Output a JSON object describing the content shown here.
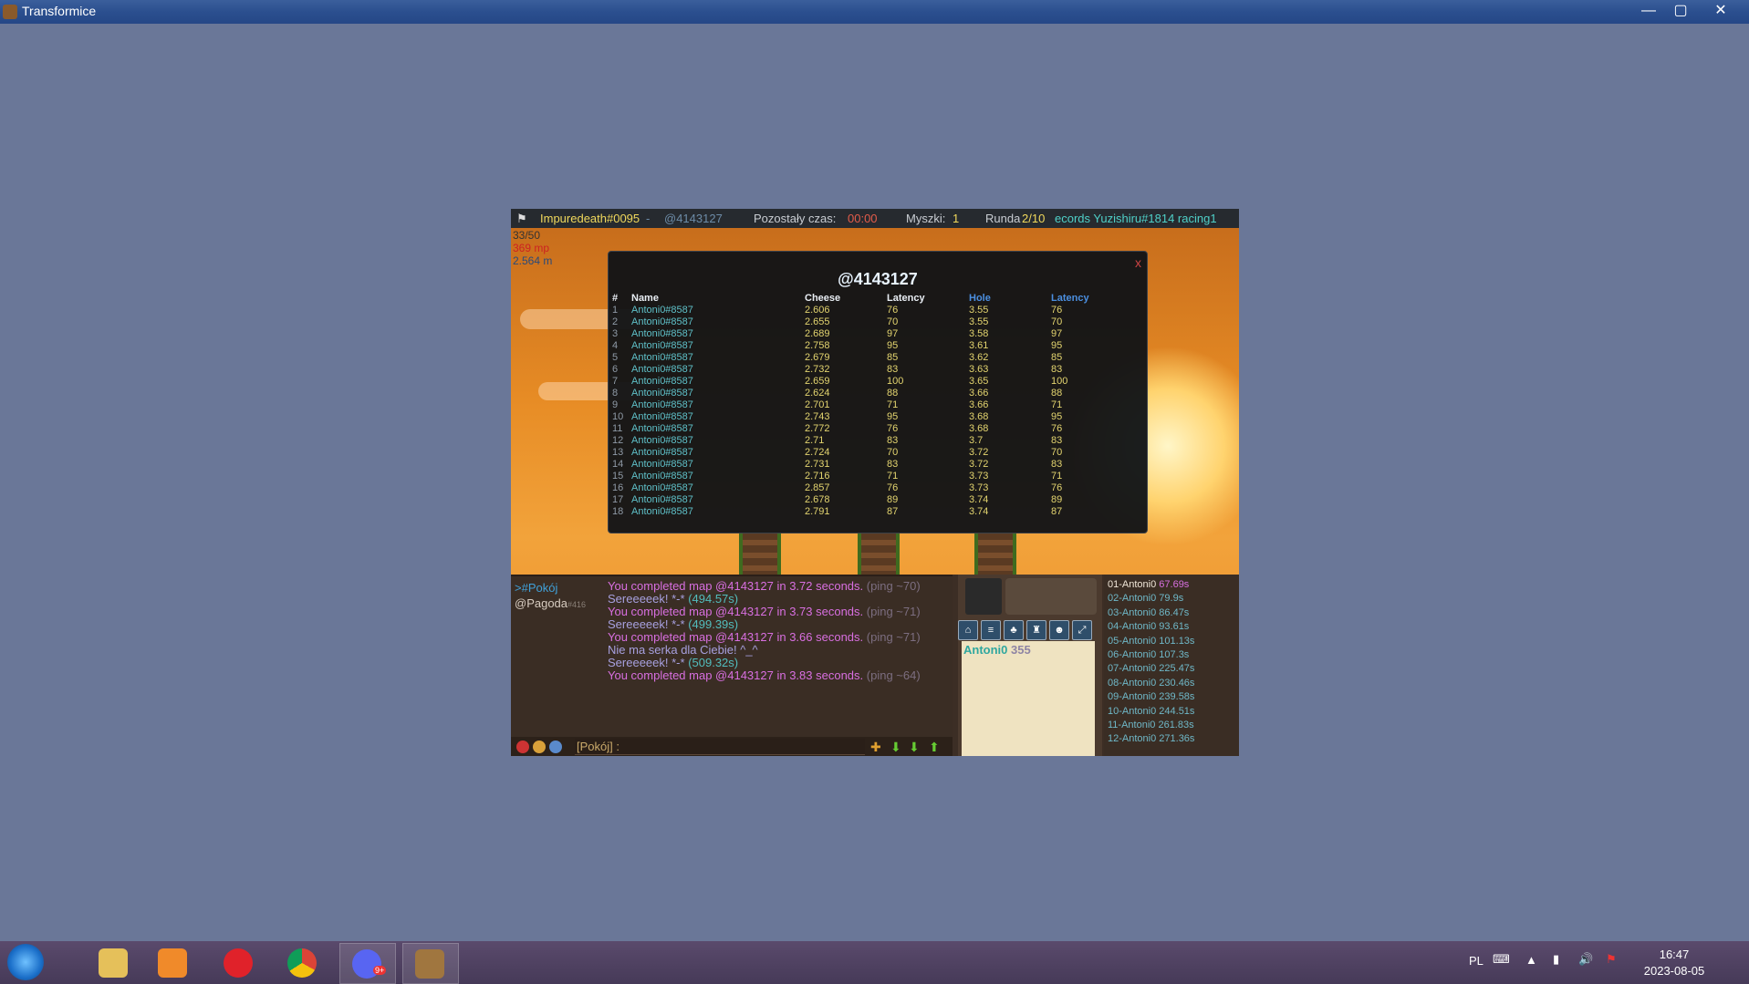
{
  "window": {
    "title": "Transformice",
    "minimize": "—",
    "maximize": "▢",
    "close": "✕"
  },
  "topbar": {
    "player": "Impuredeath#0095",
    "sep": " - ",
    "map": "@4143127",
    "time_label": "Pozostały czas:",
    "time_value": "00:00",
    "mice_label": "Myszki:",
    "mice_value": "1",
    "round_label": "Runda",
    "round_value": "2/10",
    "records_text": "ecords Yuzishiru#1814 racing1"
  },
  "stats": [
    "33/50",
    "369 mp",
    "2.564 m"
  ],
  "dialog": {
    "title": "@4143127",
    "close": "x",
    "headers": [
      "#",
      "Name",
      "Cheese",
      "Latency",
      "Hole",
      "Latency"
    ],
    "rows": [
      [
        "1",
        "Antoni0#8587",
        "2.606",
        "76",
        "3.55",
        "76"
      ],
      [
        "2",
        "Antoni0#8587",
        "2.655",
        "70",
        "3.55",
        "70"
      ],
      [
        "3",
        "Antoni0#8587",
        "2.689",
        "97",
        "3.58",
        "97"
      ],
      [
        "4",
        "Antoni0#8587",
        "2.758",
        "95",
        "3.61",
        "95"
      ],
      [
        "5",
        "Antoni0#8587",
        "2.679",
        "85",
        "3.62",
        "85"
      ],
      [
        "6",
        "Antoni0#8587",
        "2.732",
        "83",
        "3.63",
        "83"
      ],
      [
        "7",
        "Antoni0#8587",
        "2.659",
        "100",
        "3.65",
        "100"
      ],
      [
        "8",
        "Antoni0#8587",
        "2.624",
        "88",
        "3.66",
        "88"
      ],
      [
        "9",
        "Antoni0#8587",
        "2.701",
        "71",
        "3.66",
        "71"
      ],
      [
        "10",
        "Antoni0#8587",
        "2.743",
        "95",
        "3.68",
        "95"
      ],
      [
        "11",
        "Antoni0#8587",
        "2.772",
        "76",
        "3.68",
        "76"
      ],
      [
        "12",
        "Antoni0#8587",
        "2.71",
        "83",
        "3.7",
        "83"
      ],
      [
        "13",
        "Antoni0#8587",
        "2.724",
        "70",
        "3.72",
        "70"
      ],
      [
        "14",
        "Antoni0#8587",
        "2.731",
        "83",
        "3.72",
        "83"
      ],
      [
        "15",
        "Antoni0#8587",
        "2.716",
        "71",
        "3.73",
        "71"
      ],
      [
        "16",
        "Antoni0#8587",
        "2.857",
        "76",
        "3.73",
        "76"
      ],
      [
        "17",
        "Antoni0#8587",
        "2.678",
        "89",
        "3.74",
        "89"
      ],
      [
        "18",
        "Antoni0#8587",
        "2.791",
        "87",
        "3.74",
        "87"
      ]
    ]
  },
  "chat": {
    "channels": [
      ">#Pokój",
      "@Pagoda"
    ],
    "channel_suffix": "#416",
    "messages": [
      {
        "type": "m",
        "text": "You completed map @4143127 in 3.72 seconds.",
        "ping": "(ping ~70)"
      },
      {
        "type": "s",
        "text": "Sereeeeek! *-*",
        "time": "(494.57s)"
      },
      {
        "type": "m",
        "text": "You completed map @4143127 in 3.73 seconds.",
        "ping": "(ping ~71)"
      },
      {
        "type": "s",
        "text": "Sereeeeek! *-*",
        "time": "(499.39s)"
      },
      {
        "type": "m",
        "text": "You completed map @4143127 in 3.66 seconds.",
        "ping": "(ping ~71)"
      },
      {
        "type": "s",
        "text": "Nie ma serka dla Ciebie! ^_^",
        "time": ""
      },
      {
        "type": "s",
        "text": "Sereeeeek! *-*",
        "time": "(509.32s)"
      },
      {
        "type": "m",
        "text": "You completed map @4143127 in 3.83 seconds.",
        "ping": "(ping ~64)"
      }
    ],
    "input_prefix": "[Pokój] :"
  },
  "profile": {
    "name": "Antoni0",
    "score": "355"
  },
  "ranking": [
    {
      "name": "01-Antoni0",
      "time": "67.69s"
    },
    {
      "name": "02-Antoni0",
      "time": "79.9s"
    },
    {
      "name": "03-Antoni0",
      "time": "86.47s"
    },
    {
      "name": "04-Antoni0",
      "time": "93.61s"
    },
    {
      "name": "05-Antoni0",
      "time": "101.13s"
    },
    {
      "name": "06-Antoni0",
      "time": "107.3s"
    },
    {
      "name": "07-Antoni0",
      "time": "225.47s"
    },
    {
      "name": "08-Antoni0",
      "time": "230.46s"
    },
    {
      "name": "09-Antoni0",
      "time": "239.58s"
    },
    {
      "name": "10-Antoni0",
      "time": "244.51s"
    },
    {
      "name": "11-Antoni0",
      "time": "261.83s"
    },
    {
      "name": "12-Antoni0",
      "time": "271.36s"
    }
  ],
  "taskbar": {
    "language": "PL",
    "time": "16:47",
    "date": "2023-08-05",
    "apps": [
      "explorer-icon",
      "media-player-icon",
      "opera-icon",
      "chrome-icon",
      "discord-icon",
      "transformice-icon"
    ],
    "discord_badge": "9+"
  }
}
